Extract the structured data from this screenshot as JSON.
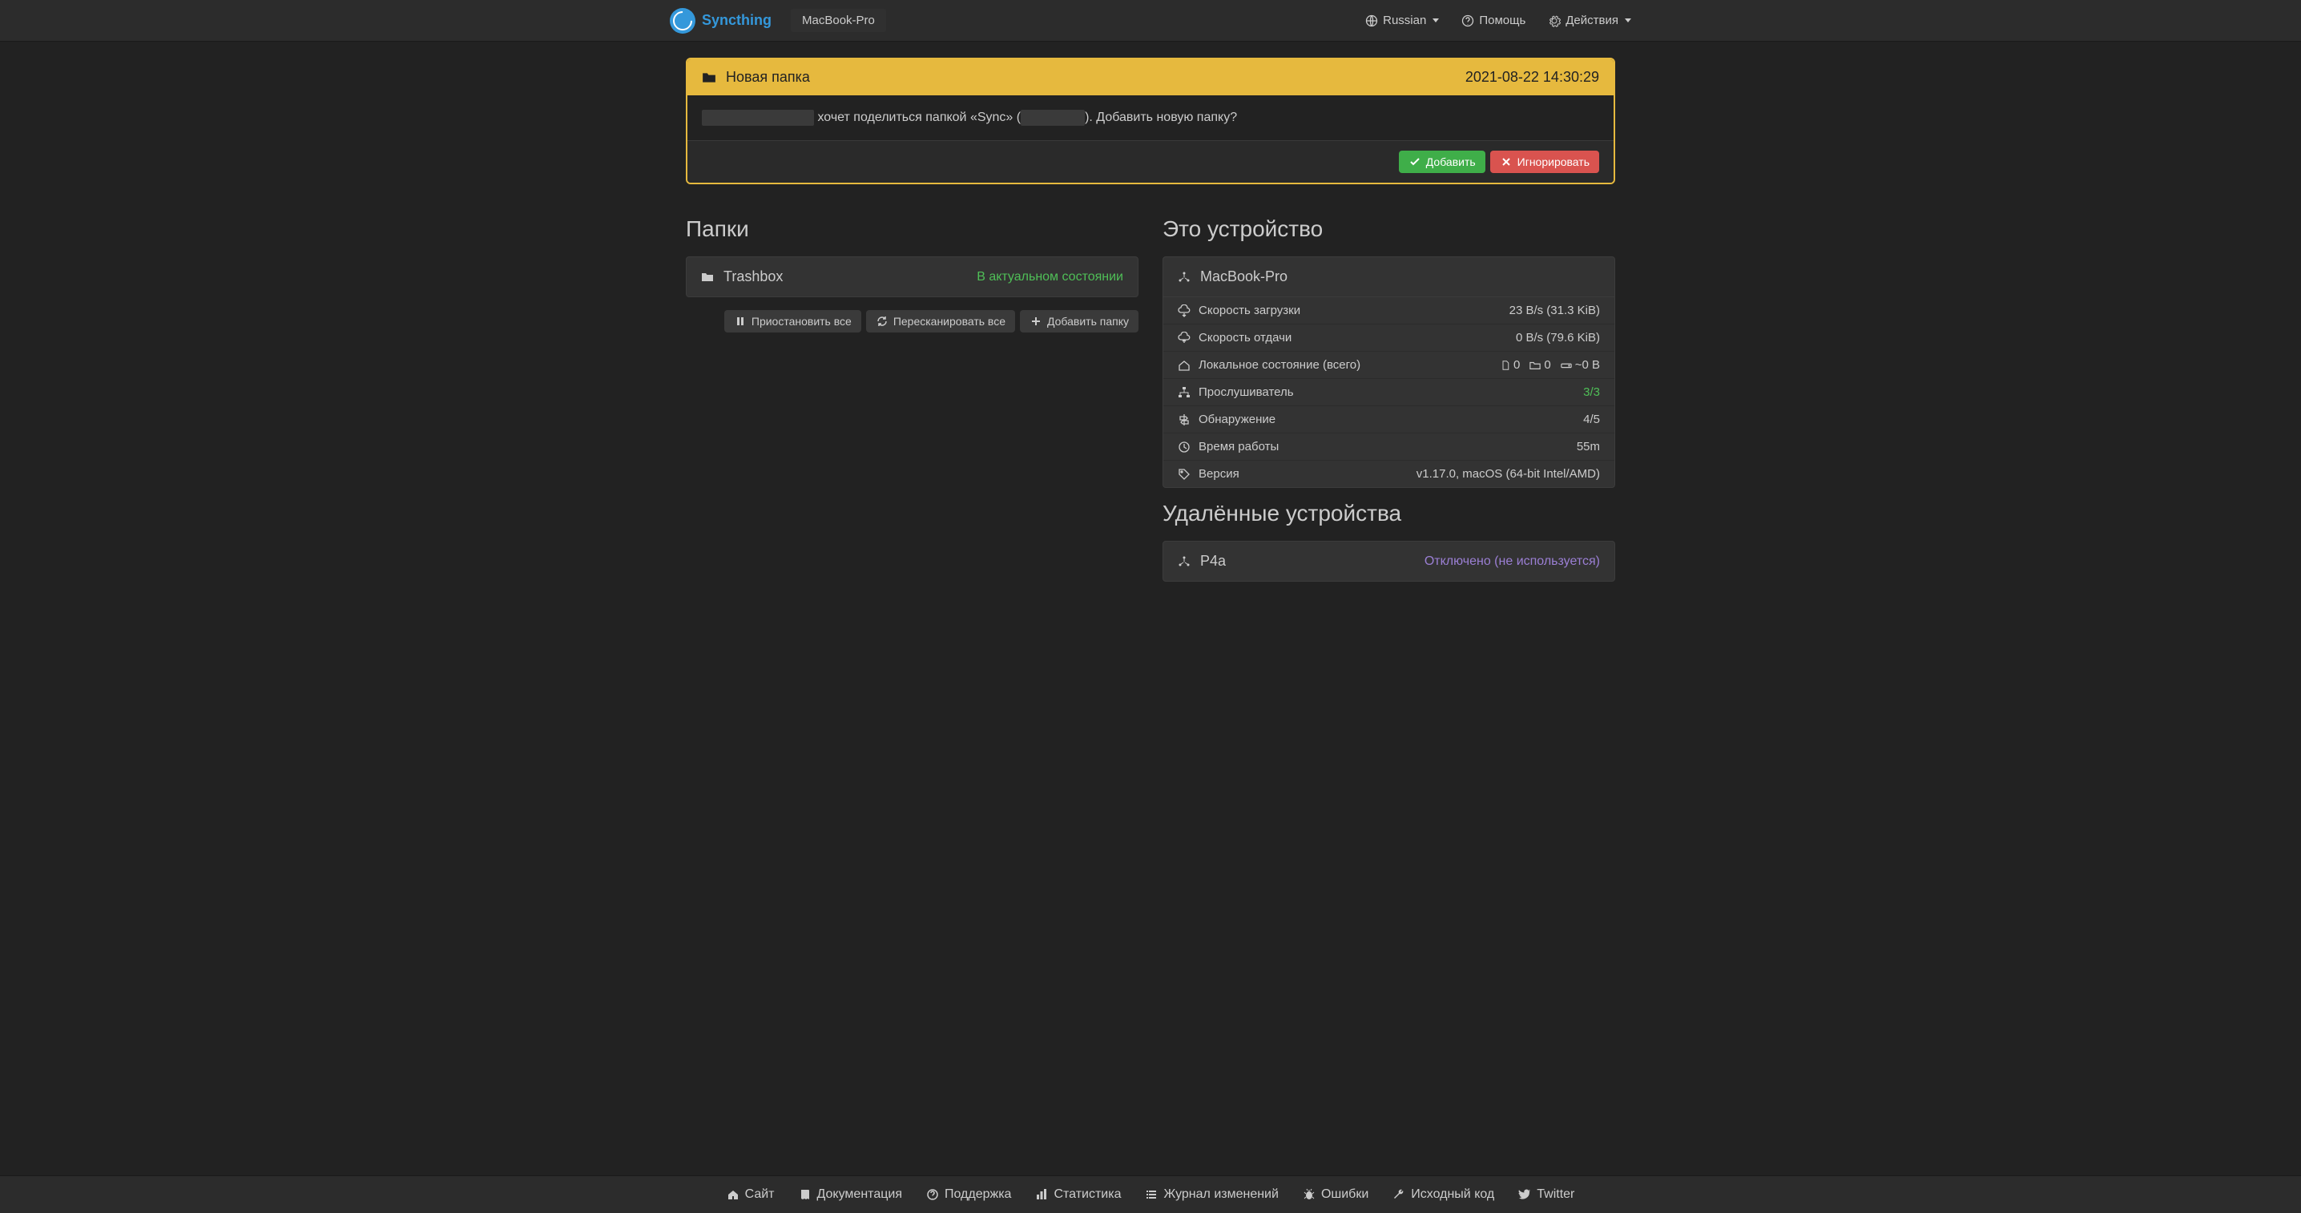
{
  "nav": {
    "brand": "Syncthing",
    "device": "MacBook-Pro",
    "language": "Russian",
    "help": "Помощь",
    "actions": "Действия"
  },
  "alert": {
    "title": "Новая папка",
    "timestamp": "2021-08-22 14:30:29",
    "msg_part1": " хочет поделиться папкой «Sync» (",
    "msg_part2": "). Добавить новую папку?",
    "add": "Добавить",
    "ignore": "Игнорировать"
  },
  "folders": {
    "heading": "Папки",
    "item_name": "Trashbox",
    "item_status": "В актуальном состоянии",
    "pause_all": "Приостановить все",
    "rescan_all": "Пересканировать все",
    "add_folder": "Добавить папку"
  },
  "this_device": {
    "heading": "Это устройство",
    "name": "MacBook-Pro",
    "rows": {
      "download_label": "Скорость загрузки",
      "download_value": "23 B/s (31.3 KiB)",
      "upload_label": "Скорость отдачи",
      "upload_value": "0 B/s (79.6 KiB)",
      "local_label": "Локальное состояние (всего)",
      "local_files": "0",
      "local_folders": "0",
      "local_size": "~0 B",
      "listeners_label": "Прослушиватель",
      "listeners_value": "3/3",
      "discovery_label": "Обнаружение",
      "discovery_value": "4/5",
      "uptime_label": "Время работы",
      "uptime_value": "55m",
      "version_label": "Версия",
      "version_value": "v1.17.0, macOS (64-bit Intel/AMD)"
    }
  },
  "remote": {
    "heading": "Удалённые устройства",
    "item_name": "P4a",
    "item_status": "Отключено (не используется)"
  },
  "footer": {
    "site": "Сайт",
    "docs": "Документация",
    "support": "Поддержка",
    "stats": "Статистика",
    "changelog": "Журнал изменений",
    "bugs": "Ошибки",
    "source": "Исходный код",
    "twitter": "Twitter"
  }
}
